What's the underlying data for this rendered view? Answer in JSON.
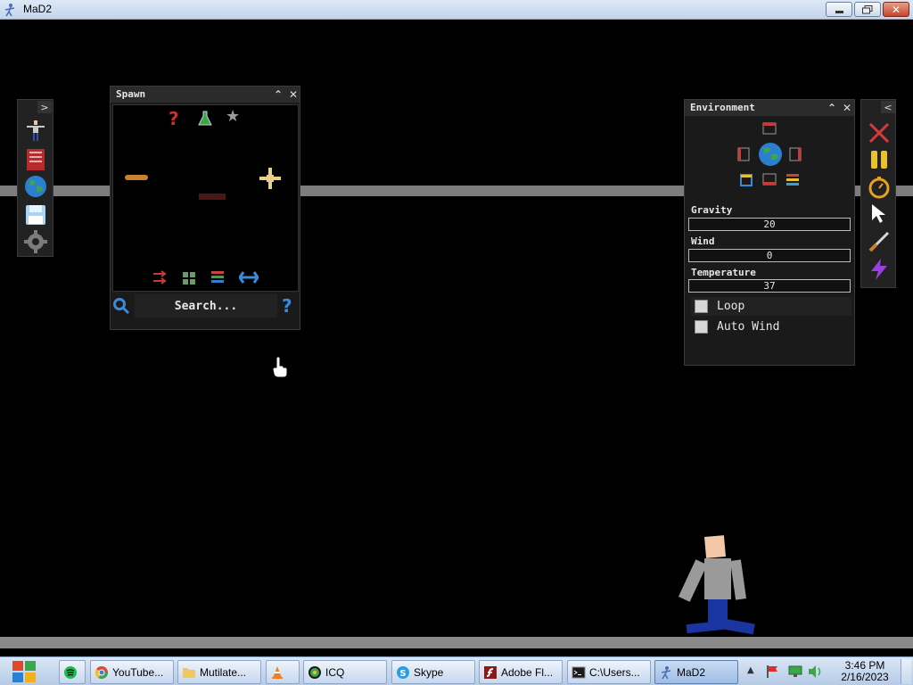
{
  "window": {
    "title": "MaD2",
    "icon": "stickman-icon",
    "controls": [
      "minimize",
      "restore",
      "close"
    ]
  },
  "left_toolbar": {
    "items": [
      {
        "name": "ragdoll-icon"
      },
      {
        "name": "book-icon"
      },
      {
        "name": "globe-icon"
      },
      {
        "name": "save-icon"
      },
      {
        "name": "gear-icon"
      }
    ]
  },
  "spawn": {
    "title": "Spawn",
    "search_placeholder": "Search...",
    "icons": [
      "question-icon",
      "flask-icon",
      "star-icon",
      "log-item-icon",
      "sparkle-item-icon",
      "cannon-item-icon",
      "shuffle-icon",
      "grid-icon",
      "list-icon",
      "swap-icon"
    ]
  },
  "environment": {
    "title": "Environment",
    "gravity_label": "Gravity",
    "gravity_value": "20",
    "wind_label": "Wind",
    "wind_value": "0",
    "temperature_label": "Temperature",
    "temperature_value": "37",
    "loop_label": "Loop",
    "auto_wind_label": "Auto Wind"
  },
  "right_toolbar": {
    "items": [
      {
        "name": "delete-icon"
      },
      {
        "name": "pause-icon"
      },
      {
        "name": "stopwatch-icon"
      },
      {
        "name": "pointer-icon"
      },
      {
        "name": "knife-icon"
      },
      {
        "name": "lightning-icon"
      }
    ]
  },
  "taskbar": {
    "items": [
      {
        "label": "",
        "icon": "spotify-icon"
      },
      {
        "label": "YouTube...",
        "icon": "chrome-icon"
      },
      {
        "label": "Mutilate...",
        "icon": "folder-icon"
      },
      {
        "label": "",
        "icon": "vlc-icon"
      },
      {
        "label": "ICQ",
        "icon": "icq-icon"
      },
      {
        "label": "Skype",
        "icon": "skype-icon"
      },
      {
        "label": "Adobe Fl...",
        "icon": "flash-icon"
      },
      {
        "label": "C:\\Users...",
        "icon": "cmd-icon"
      },
      {
        "label": "MaD2",
        "icon": "mad2-icon"
      }
    ],
    "time": "3:46 PM",
    "date": "2/16/2023"
  }
}
